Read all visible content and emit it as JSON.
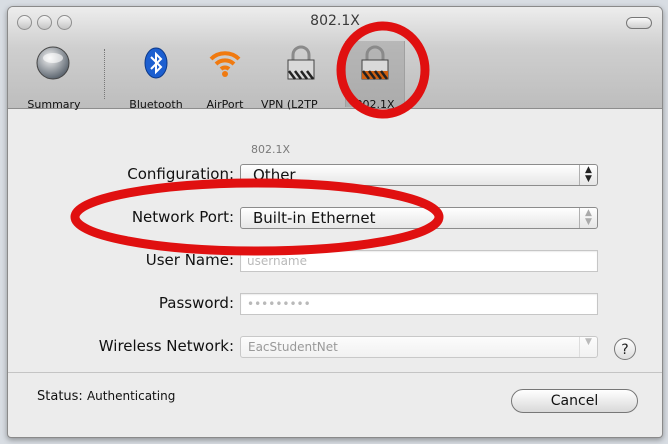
{
  "window": {
    "title": "802.1X"
  },
  "toolbar": {
    "items": [
      {
        "label": "Summary",
        "icon": "summary-globe-icon"
      },
      {
        "label": "Bluetooth",
        "icon": "bluetooth-icon"
      },
      {
        "label": "AirPort",
        "icon": "airport-wifi-icon"
      },
      {
        "label": "VPN (L2TP",
        "icon": "padlock-icon"
      },
      {
        "label": "802.1X",
        "icon": "padlock-icon",
        "selected": true
      }
    ]
  },
  "form": {
    "section_title": "802.1X",
    "configuration": {
      "label": "Configuration:",
      "value": "Other"
    },
    "network_port": {
      "label": "Network Port:",
      "value": "Built-in Ethernet"
    },
    "user_name": {
      "label": "User Name:",
      "value": "username"
    },
    "password": {
      "label": "Password:",
      "value": "•••••••••"
    },
    "wireless_network": {
      "label": "Wireless Network:",
      "value": "EacStudentNet"
    },
    "help": "?"
  },
  "footer": {
    "status_label": "Status:",
    "status_value": "Authenticating",
    "cancel_label": "Cancel"
  },
  "colors": {
    "annotation_red": "#e01010"
  }
}
